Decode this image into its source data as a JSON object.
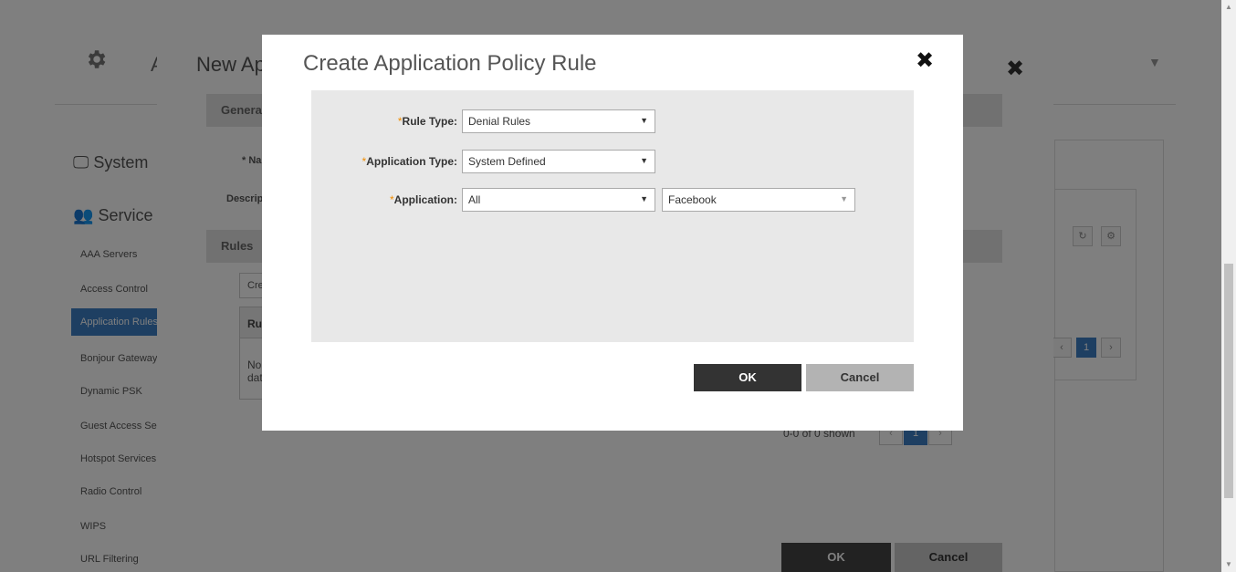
{
  "background_page": {
    "title_stub": "A",
    "nav": {
      "system_label": "System",
      "services_label": "Service",
      "items": [
        {
          "label": "AAA Servers"
        },
        {
          "label": "Access Control"
        },
        {
          "label": "Application Rules"
        },
        {
          "label": "Bonjour Gateway"
        },
        {
          "label": "Dynamic PSK"
        },
        {
          "label": "Guest Access Services"
        },
        {
          "label": "Hotspot Services"
        },
        {
          "label": "Radio Control"
        },
        {
          "label": "WIPS"
        },
        {
          "label": "URL Filtering"
        }
      ]
    },
    "right_panel": {
      "refresh_icon": "↻",
      "settings_icon": "⚙",
      "page_prev": "‹",
      "page_current": "1",
      "page_next": "›"
    }
  },
  "policy_dialog": {
    "title": "New Application Policy",
    "close_label": "✖",
    "general_section": "General Options",
    "name_label": "* Name",
    "description_label": "Description",
    "rules_section": "Rules",
    "create_button": "Create",
    "rules_table_header": "Rule",
    "rules_table_empty": "No data",
    "pagination": {
      "shown": "0-0 of 0 shown",
      "prev": "‹",
      "current": "1",
      "next": "›"
    },
    "ok_label": "OK",
    "cancel_label": "Cancel"
  },
  "rule_dialog": {
    "title": "Create Application Policy Rule",
    "close_label": "✖",
    "fields": {
      "rule_type": {
        "required_mark": "*",
        "label": "Rule Type:",
        "value": "Denial Rules"
      },
      "application_type": {
        "required_mark": "*",
        "label": "Application Type:",
        "value": "System Defined"
      },
      "application": {
        "required_mark": "*",
        "label": "Application:",
        "value": "All",
        "second_value": "Facebook"
      }
    },
    "ok_label": "OK",
    "cancel_label": "Cancel"
  },
  "scrollbar": {
    "up": "▲",
    "down": "▼"
  },
  "colors": {
    "accent": "#3d7fc4",
    "required": "#f08c00",
    "ok_button": "#333333",
    "cancel_button": "#b3b3b3"
  }
}
